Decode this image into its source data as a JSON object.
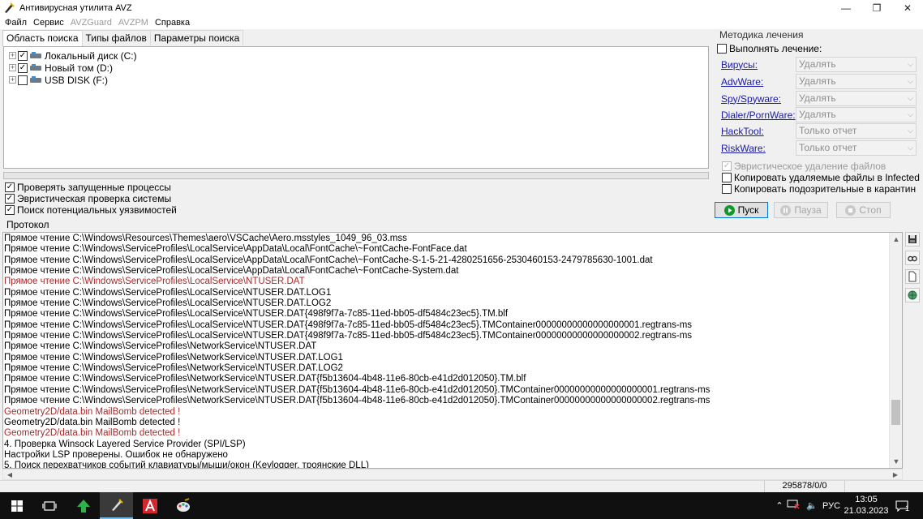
{
  "window": {
    "title": "Антивирусная утилита AVZ",
    "buttons": {
      "minimize": "—",
      "maximize": "❐",
      "close": "✕"
    }
  },
  "menu": [
    {
      "label": "Файл",
      "enabled": true
    },
    {
      "label": "Сервис",
      "enabled": true
    },
    {
      "label": "AVZGuard",
      "enabled": false
    },
    {
      "label": "AVZPM",
      "enabled": false
    },
    {
      "label": "Справка",
      "enabled": true
    }
  ],
  "tabs": [
    "Область поиска",
    "Типы файлов",
    "Параметры поиска"
  ],
  "drives": [
    {
      "label": "Локальный диск (C:)",
      "checked": true
    },
    {
      "label": "Новый том (D:)",
      "checked": true
    },
    {
      "label": "USB DISK (F:)",
      "checked": false
    }
  ],
  "progress": {
    "fraction": 0.0
  },
  "scan_options": [
    {
      "label": "Проверять запущенные процессы",
      "checked": true
    },
    {
      "label": "Эвристическая проверка системы",
      "checked": true
    },
    {
      "label": "Поиск потенциальных уязвимостей",
      "checked": true
    }
  ],
  "treatment": {
    "title": "Методика лечения",
    "do_treat": "Выполнять лечение:",
    "rows": [
      {
        "link": "Вирусы:",
        "value": "Удалять"
      },
      {
        "link": "AdvWare:",
        "value": "Удалять"
      },
      {
        "link": "Spy/Spyware:",
        "value": "Удалять"
      },
      {
        "link": "Dialer/PornWare:",
        "value": "Удалять"
      },
      {
        "link": "HackTool:",
        "value": "Только отчет"
      },
      {
        "link": "RiskWare:",
        "value": "Только отчет"
      }
    ],
    "heuristic_delete": "Эвристическое удаление файлов",
    "copy_deleted": "Копировать удаляемые файлы в  Infected",
    "copy_suspicious": "Копировать подозрительные в  карантин"
  },
  "buttons": {
    "start": "Пуск",
    "pause": "Пауза",
    "stop": "Стоп"
  },
  "protocol": {
    "label": "Протокол",
    "lines": [
      {
        "text": "Прямое чтение C:\\Windows\\Resources\\Themes\\aero\\VSCache\\Aero.msstyles_1049_96_03.mss",
        "red": false
      },
      {
        "text": "Прямое чтение C:\\Windows\\ServiceProfiles\\LocalService\\AppData\\Local\\FontCache\\~FontCache-FontFace.dat",
        "red": false
      },
      {
        "text": "Прямое чтение C:\\Windows\\ServiceProfiles\\LocalService\\AppData\\Local\\FontCache\\~FontCache-S-1-5-21-4280251656-2530460153-2479785630-1001.dat",
        "red": false
      },
      {
        "text": "Прямое чтение C:\\Windows\\ServiceProfiles\\LocalService\\AppData\\Local\\FontCache\\~FontCache-System.dat",
        "red": false
      },
      {
        "text": "Прямое чтение C:\\Windows\\ServiceProfiles\\LocalService\\NTUSER.DAT",
        "red": true
      },
      {
        "text": "Прямое чтение C:\\Windows\\ServiceProfiles\\LocalService\\NTUSER.DAT.LOG1",
        "red": false
      },
      {
        "text": "Прямое чтение C:\\Windows\\ServiceProfiles\\LocalService\\NTUSER.DAT.LOG2",
        "red": false
      },
      {
        "text": "Прямое чтение C:\\Windows\\ServiceProfiles\\LocalService\\NTUSER.DAT{498f9f7a-7c85-11ed-bb05-df5484c23ec5}.TM.blf",
        "red": false
      },
      {
        "text": "Прямое чтение C:\\Windows\\ServiceProfiles\\LocalService\\NTUSER.DAT{498f9f7a-7c85-11ed-bb05-df5484c23ec5}.TMContainer00000000000000000001.regtrans-ms",
        "red": false
      },
      {
        "text": "Прямое чтение C:\\Windows\\ServiceProfiles\\LocalService\\NTUSER.DAT{498f9f7a-7c85-11ed-bb05-df5484c23ec5}.TMContainer00000000000000000002.regtrans-ms",
        "red": false
      },
      {
        "text": "Прямое чтение C:\\Windows\\ServiceProfiles\\NetworkService\\NTUSER.DAT",
        "red": false
      },
      {
        "text": "Прямое чтение C:\\Windows\\ServiceProfiles\\NetworkService\\NTUSER.DAT.LOG1",
        "red": false
      },
      {
        "text": "Прямое чтение C:\\Windows\\ServiceProfiles\\NetworkService\\NTUSER.DAT.LOG2",
        "red": false
      },
      {
        "text": "Прямое чтение C:\\Windows\\ServiceProfiles\\NetworkService\\NTUSER.DAT{f5b13604-4b48-11e6-80cb-e41d2d012050}.TM.blf",
        "red": false
      },
      {
        "text": "Прямое чтение C:\\Windows\\ServiceProfiles\\NetworkService\\NTUSER.DAT{f5b13604-4b48-11e6-80cb-e41d2d012050}.TMContainer00000000000000000001.regtrans-ms",
        "red": false
      },
      {
        "text": "Прямое чтение C:\\Windows\\ServiceProfiles\\NetworkService\\NTUSER.DAT{f5b13604-4b48-11e6-80cb-e41d2d012050}.TMContainer00000000000000000002.regtrans-ms",
        "red": false
      },
      {
        "text": " Geometry2D/data.bin MailBomb detected !",
        "red": true
      },
      {
        "text": " Geometry2D/data.bin MailBomb detected !",
        "red": false
      },
      {
        "text": " Geometry2D/data.bin MailBomb detected !",
        "red": true
      },
      {
        "text": "4. Проверка Winsock Layered Service Provider (SPI/LSP)",
        "red": false
      },
      {
        "text": " Настройки LSP проверены. Ошибок не обнаружено",
        "red": false
      },
      {
        "text": "5. Поиск перехватчиков событий клавиатуры/мыши/окон (Keylogger, троянские DLL)",
        "red": false
      }
    ]
  },
  "status": {
    "counts": "295878/0/0"
  },
  "taskbar": {
    "lang": "РУС",
    "time": "13:05",
    "date": "21.03.2023",
    "notifications": "1"
  },
  "colors": {
    "accent": "#0078d7",
    "progress_green": "#06b025",
    "log_red": "#a52a2a",
    "link_blue": "#1a1aa6"
  }
}
